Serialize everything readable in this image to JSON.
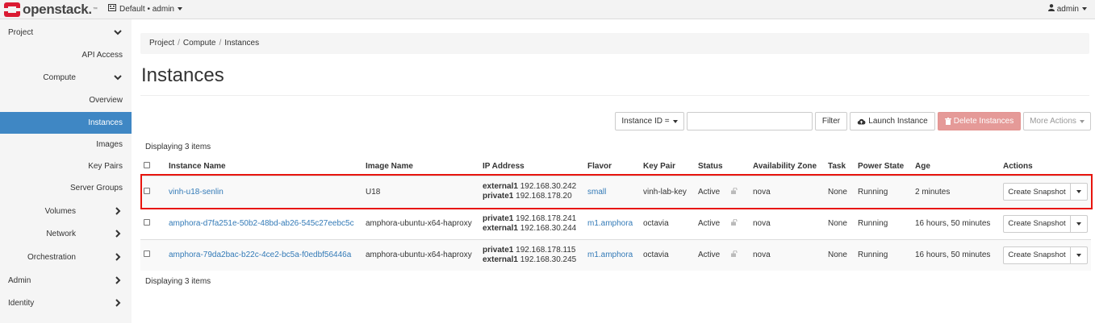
{
  "topbar": {
    "brand": "openstack.",
    "brand_tm": "™",
    "project_switch": "Default • admin",
    "user": "admin"
  },
  "sidebar": {
    "items": [
      {
        "label": "Project",
        "chevron": "down"
      },
      {
        "label": "API Access"
      },
      {
        "label": "Compute",
        "chevron": "down"
      },
      {
        "label": "Overview"
      },
      {
        "label": "Instances",
        "active": true
      },
      {
        "label": "Images"
      },
      {
        "label": "Key Pairs"
      },
      {
        "label": "Server Groups"
      },
      {
        "label": "Volumes",
        "chevron": "right"
      },
      {
        "label": "Network",
        "chevron": "right"
      },
      {
        "label": "Orchestration",
        "chevron": "right"
      },
      {
        "label": "Admin",
        "chevron": "right"
      },
      {
        "label": "Identity",
        "chevron": "right"
      }
    ]
  },
  "breadcrumb": [
    "Project",
    "Compute",
    "Instances"
  ],
  "page_title": "Instances",
  "toolbar": {
    "filter_select": "Instance ID =",
    "filter_input_value": "",
    "filter_button": "Filter",
    "launch_button": "Launch Instance",
    "delete_button": "Delete Instances",
    "more_button": "More Actions"
  },
  "table": {
    "display_count_top": "Displaying 3 items",
    "display_count_bottom": "Displaying 3 items",
    "columns": [
      "Instance Name",
      "Image Name",
      "IP Address",
      "Flavor",
      "Key Pair",
      "Status",
      "Availability Zone",
      "Task",
      "Power State",
      "Age",
      "Actions"
    ],
    "rows": [
      {
        "name": "vinh-u18-senlin",
        "image": "U18",
        "ips": [
          {
            "net": "external1",
            "ip": "192.168.30.242"
          },
          {
            "net": "private1",
            "ip": "192.168.178.20"
          }
        ],
        "flavor": "small",
        "keypair": "vinh-lab-key",
        "status": "Active",
        "az": "nova",
        "task": "None",
        "power": "Running",
        "age": "2 minutes",
        "action": "Create Snapshot"
      },
      {
        "name": "amphora-d7fa251e-50b2-48bd-ab26-545c27eebc5c",
        "image": "amphora-ubuntu-x64-haproxy",
        "ips": [
          {
            "net": "private1",
            "ip": "192.168.178.241"
          },
          {
            "net": "external1",
            "ip": "192.168.30.244"
          }
        ],
        "flavor": "m1.amphora",
        "keypair": "octavia",
        "status": "Active",
        "az": "nova",
        "task": "None",
        "power": "Running",
        "age": "16 hours, 50 minutes",
        "action": "Create Snapshot"
      },
      {
        "name": "amphora-79da2bac-b22c-4ce2-bc5a-f0edbf56446a",
        "image": "amphora-ubuntu-x64-haproxy",
        "ips": [
          {
            "net": "private1",
            "ip": "192.168.178.115"
          },
          {
            "net": "external1",
            "ip": "192.168.30.245"
          }
        ],
        "flavor": "m1.amphora",
        "keypair": "octavia",
        "status": "Active",
        "az": "nova",
        "task": "None",
        "power": "Running",
        "age": "16 hours, 50 minutes",
        "action": "Create Snapshot"
      }
    ]
  },
  "colors": {
    "accent": "#3f87c4",
    "link": "#337ab7",
    "danger_disabled": "#e59a98",
    "highlight_box": "#e8150e",
    "brand_red": "#da1a32"
  },
  "icons": {
    "brand": "openstack-logo-icon",
    "project": "building-icon",
    "user": "user-icon",
    "launch": "cloud-upload-icon",
    "delete": "trash-icon",
    "lock": "unlock-icon"
  }
}
